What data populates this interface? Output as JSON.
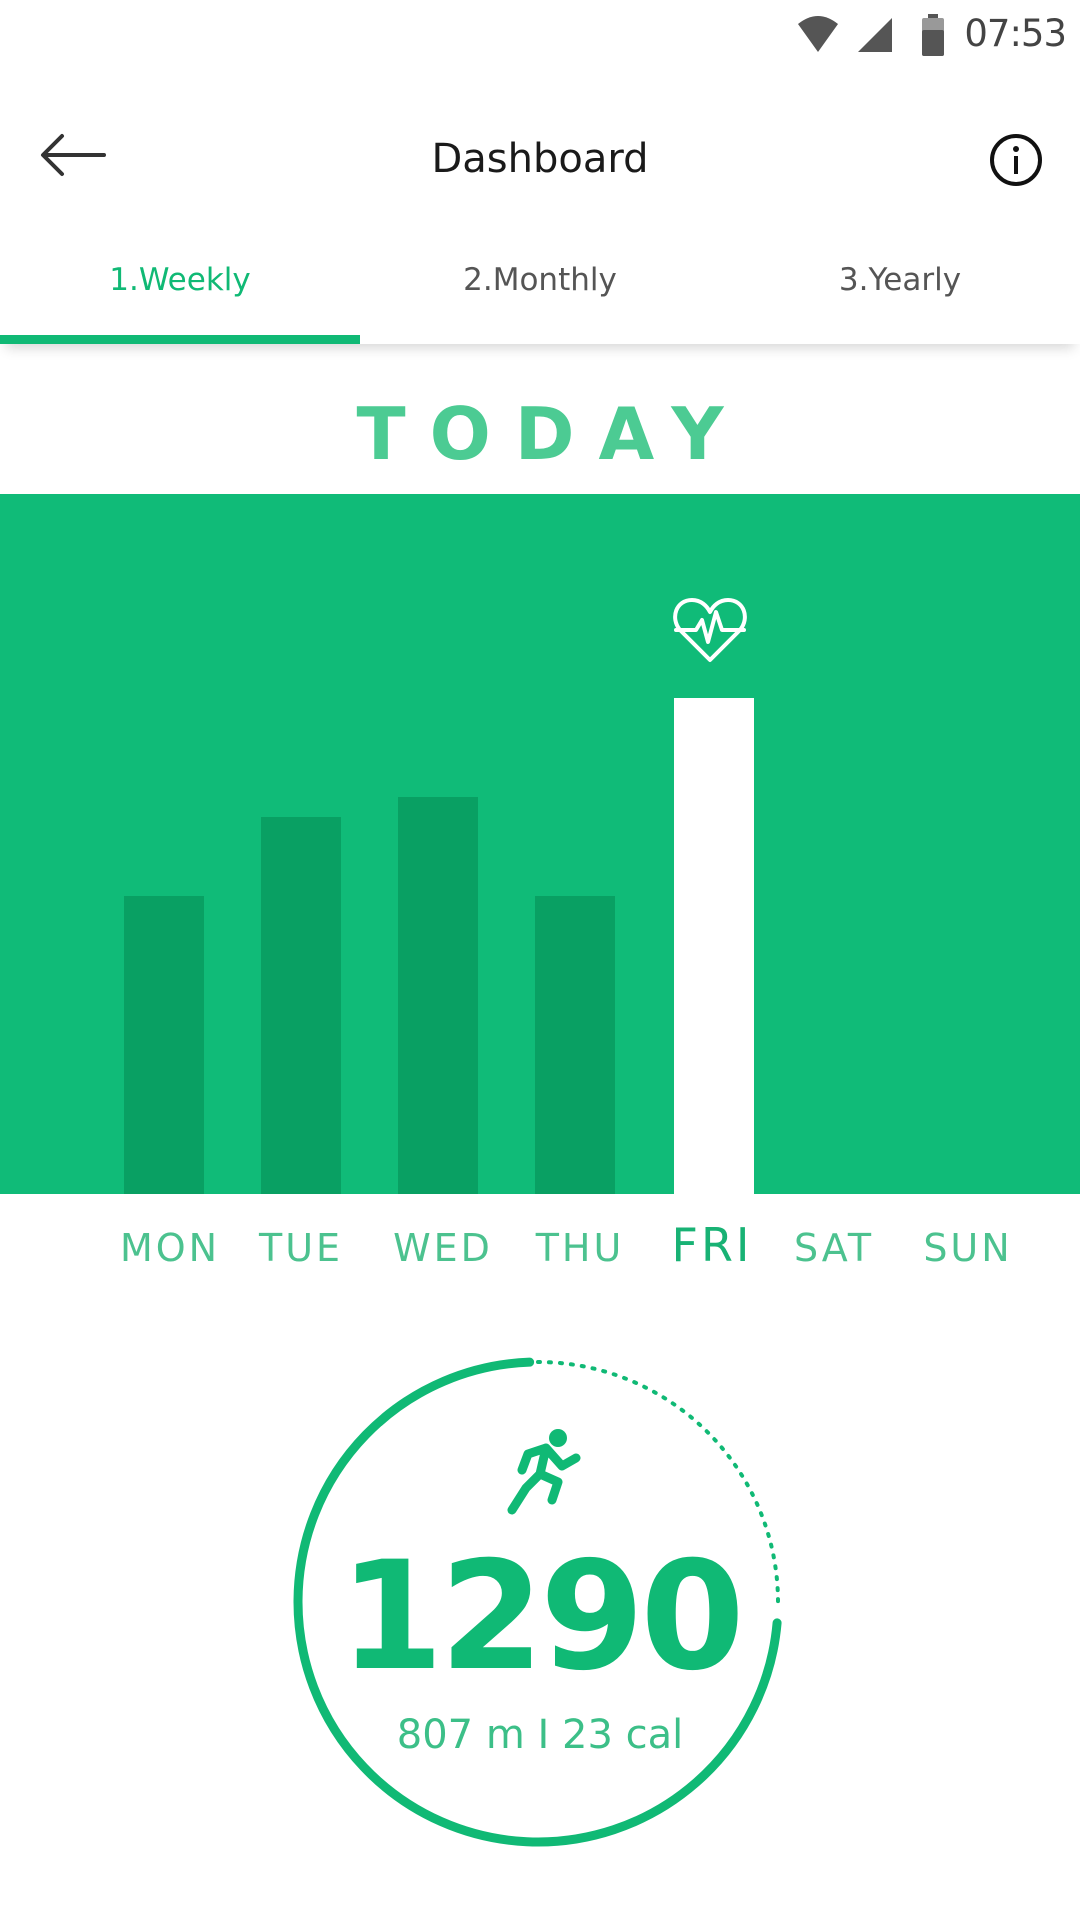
{
  "status_bar": {
    "time": "07:53"
  },
  "app_bar": {
    "title": "Dashboard"
  },
  "tabs": [
    {
      "label": "1.Weekly",
      "active": true
    },
    {
      "label": "2.Monthly",
      "active": false
    },
    {
      "label": "3.Yearly",
      "active": false
    }
  ],
  "heading": "TODAY",
  "chart_data": {
    "type": "bar",
    "categories": [
      "MON",
      "TUE",
      "WED",
      "THU",
      "FRI",
      "SAT",
      "SUN"
    ],
    "values": [
      300,
      380,
      400,
      300,
      500,
      null,
      null
    ],
    "highlight": "FRI",
    "highlight_icon": "heart-pulse-icon",
    "colors": {
      "background": "#10bb78",
      "bar": "#09a063",
      "highlight_bar": "#ffffff"
    }
  },
  "summary": {
    "steps": "1290",
    "detail": "807 m I 23 cal",
    "progress": 0.75,
    "icon": "running-icon",
    "accent_color": "#10b975"
  }
}
